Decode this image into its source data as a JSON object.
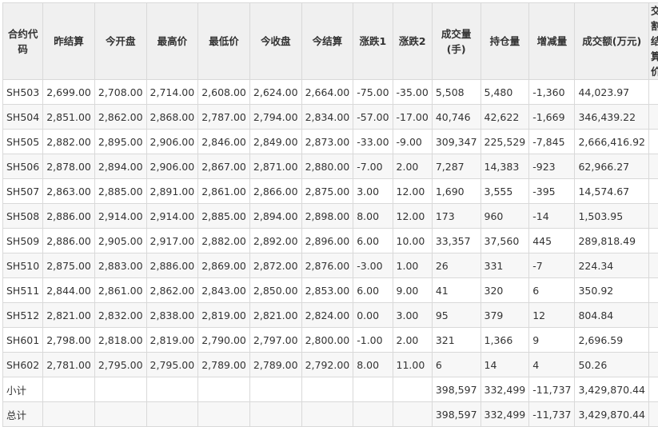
{
  "headers": [
    "合约代码",
    "昨结算",
    "今开盘",
    "最高价",
    "最低价",
    "今收盘",
    "今结算",
    "涨跌1",
    "涨跌2",
    "成交量(手)",
    "持仓量",
    "增减量",
    "成交额(万元)",
    "交割结算价"
  ],
  "rows": [
    [
      "SH503",
      "2,699.00",
      "2,708.00",
      "2,714.00",
      "2,608.00",
      "2,624.00",
      "2,664.00",
      "-75.00",
      "-35.00",
      "5,508",
      "5,480",
      "-1,360",
      "44,023.97",
      ""
    ],
    [
      "SH504",
      "2,851.00",
      "2,862.00",
      "2,868.00",
      "2,787.00",
      "2,794.00",
      "2,834.00",
      "-57.00",
      "-17.00",
      "40,746",
      "42,622",
      "-1,669",
      "346,439.22",
      ""
    ],
    [
      "SH505",
      "2,882.00",
      "2,895.00",
      "2,906.00",
      "2,846.00",
      "2,849.00",
      "2,873.00",
      "-33.00",
      "-9.00",
      "309,347",
      "225,529",
      "-7,845",
      "2,666,416.92",
      ""
    ],
    [
      "SH506",
      "2,878.00",
      "2,894.00",
      "2,906.00",
      "2,867.00",
      "2,871.00",
      "2,880.00",
      "-7.00",
      "2.00",
      "7,287",
      "14,383",
      "-923",
      "62,966.27",
      ""
    ],
    [
      "SH507",
      "2,863.00",
      "2,885.00",
      "2,891.00",
      "2,861.00",
      "2,866.00",
      "2,875.00",
      "3.00",
      "12.00",
      "1,690",
      "3,555",
      "-395",
      "14,574.67",
      ""
    ],
    [
      "SH508",
      "2,886.00",
      "2,914.00",
      "2,914.00",
      "2,885.00",
      "2,894.00",
      "2,898.00",
      "8.00",
      "12.00",
      "173",
      "960",
      "-14",
      "1,503.95",
      ""
    ],
    [
      "SH509",
      "2,886.00",
      "2,905.00",
      "2,917.00",
      "2,882.00",
      "2,892.00",
      "2,896.00",
      "6.00",
      "10.00",
      "33,357",
      "37,560",
      "445",
      "289,818.49",
      ""
    ],
    [
      "SH510",
      "2,875.00",
      "2,883.00",
      "2,886.00",
      "2,869.00",
      "2,872.00",
      "2,876.00",
      "-3.00",
      "1.00",
      "26",
      "331",
      "-7",
      "224.34",
      ""
    ],
    [
      "SH511",
      "2,844.00",
      "2,861.00",
      "2,862.00",
      "2,843.00",
      "2,850.00",
      "2,853.00",
      "6.00",
      "9.00",
      "41",
      "320",
      "6",
      "350.92",
      ""
    ],
    [
      "SH512",
      "2,821.00",
      "2,832.00",
      "2,838.00",
      "2,819.00",
      "2,821.00",
      "2,824.00",
      "0.00",
      "3.00",
      "95",
      "379",
      "12",
      "804.84",
      ""
    ],
    [
      "SH601",
      "2,798.00",
      "2,818.00",
      "2,819.00",
      "2,790.00",
      "2,797.00",
      "2,800.00",
      "-1.00",
      "2.00",
      "321",
      "1,366",
      "9",
      "2,696.59",
      ""
    ],
    [
      "SH602",
      "2,781.00",
      "2,795.00",
      "2,795.00",
      "2,789.00",
      "2,789.00",
      "2,792.00",
      "8.00",
      "11.00",
      "6",
      "14",
      "4",
      "50.26",
      ""
    ],
    [
      "小计",
      "",
      "",
      "",
      "",
      "",
      "",
      "",
      "",
      "398,597",
      "332,499",
      "-11,737",
      "3,429,870.44",
      ""
    ],
    [
      "总计",
      "",
      "",
      "",
      "",
      "",
      "",
      "",
      "",
      "398,597",
      "332,499",
      "-11,737",
      "3,429,870.44",
      ""
    ]
  ]
}
